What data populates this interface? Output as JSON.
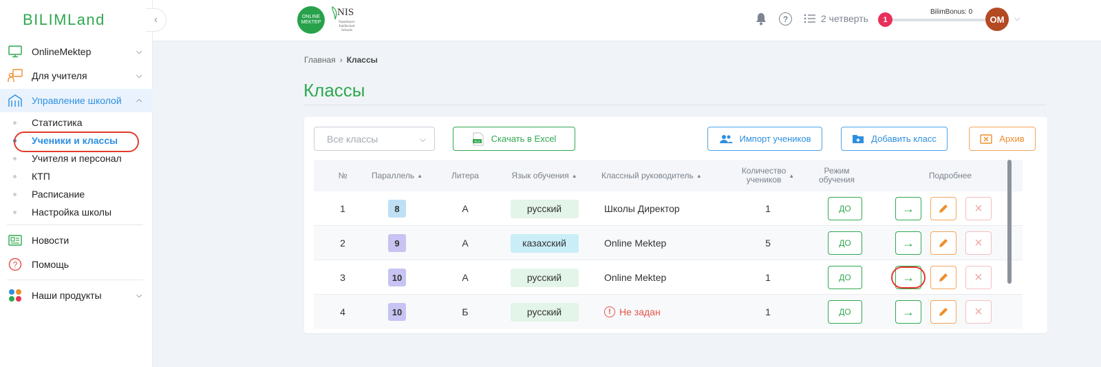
{
  "app": {
    "logo_text": "BILIMLand"
  },
  "sidebar": {
    "items": [
      {
        "label": "OnlineMektep"
      },
      {
        "label": "Для учителя"
      },
      {
        "label": "Управление школой"
      }
    ],
    "sub_items": [
      {
        "label": "Статистика"
      },
      {
        "label": "Ученики и классы"
      },
      {
        "label": "Учителя и персонал"
      },
      {
        "label": "КТП"
      },
      {
        "label": "Расписание"
      },
      {
        "label": "Настройка школы"
      }
    ],
    "extra_items": [
      {
        "label": "Новости"
      },
      {
        "label": "Помощь"
      },
      {
        "label": "Наши продукты"
      }
    ]
  },
  "header": {
    "om_logo_line1": "ONLINE",
    "om_logo_line2": "MEKTEP",
    "nis_logo_text": "NIS",
    "nis_logo_sub": "Nazarbayev Intellectual Schools",
    "quarter_label": "2 четверть",
    "bonus_label": "BilimBonus: 0",
    "notification_count": "1",
    "avatar_initials": "OM"
  },
  "breadcrumb": {
    "home": "Главная",
    "current": "Классы"
  },
  "page_title": "Классы",
  "toolbar": {
    "select_placeholder": "Все классы",
    "excel_label": "Скачать в Excel",
    "excel_icon_text": "XLS",
    "import_label": "Импорт учеников",
    "add_label": "Добавить класс",
    "archive_label": "Архив"
  },
  "table": {
    "headers": {
      "num": "№",
      "parallel": "Параллель",
      "litera": "Литера",
      "language": "Язык обучения",
      "teacher": "Классный руководитель",
      "count_line1": "Количество",
      "count_line2": "учеников",
      "mode_line1": "Режим",
      "mode_line2": "обучения",
      "details": "Подробнее"
    },
    "rows": [
      {
        "num": "1",
        "parallel": "8",
        "litera": "А",
        "language": "русский",
        "teacher": "Школы Директор",
        "count": "1",
        "mode": "ДО"
      },
      {
        "num": "2",
        "parallel": "9",
        "litera": "А",
        "language": "казахский",
        "teacher": "Online Mektep",
        "count": "5",
        "mode": "ДО"
      },
      {
        "num": "3",
        "parallel": "10",
        "litera": "А",
        "language": "русский",
        "teacher": "Online Mektep",
        "count": "1",
        "mode": "ДО"
      },
      {
        "num": "4",
        "parallel": "10",
        "litera": "Б",
        "language": "русский",
        "teacher": "Не задан",
        "count": "1",
        "mode": "ДО"
      }
    ]
  },
  "colors": {
    "brand_green": "#2fa84f",
    "accent_blue": "#2d8fe0",
    "accent_orange": "#ef8e2c",
    "grade_8": "#bfe0f4",
    "grade_9": "#c7c3f2",
    "grade_10": "#c7c3f2",
    "lang_ru": "#e3f4e8",
    "lang_kz": "#c9eef8",
    "warning_red": "#e5534b"
  }
}
